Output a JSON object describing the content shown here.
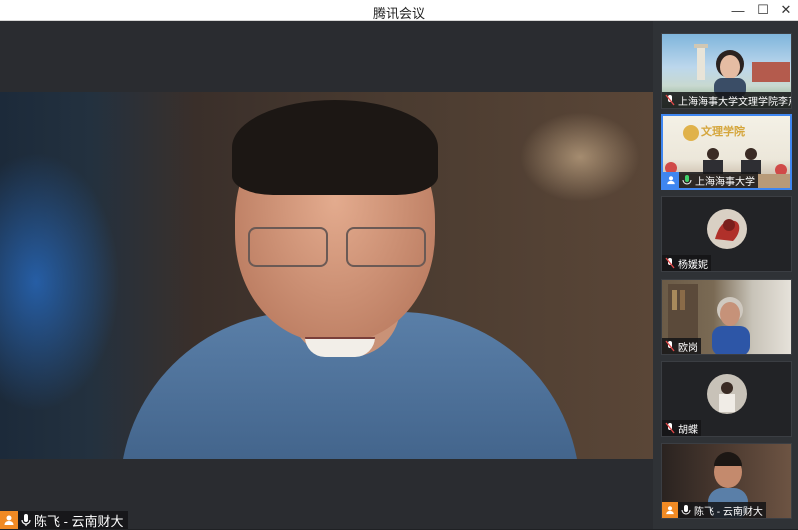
{
  "window": {
    "title": "腾讯会议",
    "min_glyph": "—",
    "max_glyph": "☐",
    "close_glyph": "✕"
  },
  "main_video": {
    "speaker_name": "陈飞 - 云南财大"
  },
  "participants": [
    {
      "name": "上海海事大学文理学院李芹",
      "active": false
    },
    {
      "name": "上海海事大学",
      "active": true,
      "banner": "文理学院"
    },
    {
      "name": "杨媛妮",
      "active": false
    },
    {
      "name": "欧岗",
      "active": false
    },
    {
      "name": "胡蝶",
      "active": false
    },
    {
      "name": "陈飞 - 云南财大",
      "active": false
    }
  ],
  "colors": {
    "accent": "#3f86f0",
    "person_badge": "#f08a24",
    "muted_mic": "#e04848"
  }
}
